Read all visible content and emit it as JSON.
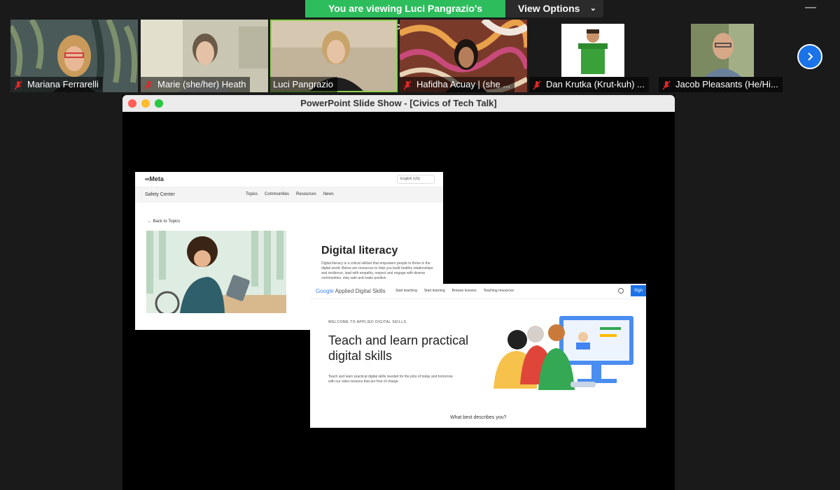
{
  "banner": {
    "viewing_text": "You are viewing Luci Pangrazio's screen",
    "view_options_label": "View Options",
    "minimize_label": "—"
  },
  "participants": [
    {
      "name": "Mariana Ferrarelli",
      "muted": true
    },
    {
      "name": "Marie (she/her) Heath",
      "muted": true
    },
    {
      "name": "Luci Pangrazio",
      "muted": false
    },
    {
      "name": "Hafidha Acuay | (she ...",
      "muted": true
    },
    {
      "name": "Dan Krutka (Krut-kuh) ...",
      "muted": true
    },
    {
      "name": "Jacob Pleasants (He/Hi...",
      "muted": true
    }
  ],
  "window": {
    "title": "PowerPoint Slide Show - [Civics of Tech Talk]"
  },
  "meta_page": {
    "logo": "∞Meta",
    "language": "English (US)",
    "section": "Safety Center",
    "nav": [
      "Topics",
      "Communities",
      "Resources",
      "News"
    ],
    "back_link": "← Back to Topics",
    "heading": "Digital literacy",
    "body": "Digital literacy is a critical skillset that empowers people to thrive in the digital world. Below are resources to help you build healthy relationships and resilience, lead with empathy, respect and engage with diverse communities, stay safe and make positive"
  },
  "google_page": {
    "logo_google": "Google",
    "logo_product": "Applied Digital Skills",
    "nav": [
      "Start teaching",
      "Start learning",
      "Browse lessons",
      "Teaching resources"
    ],
    "signin": "Sign",
    "eyebrow": "WELCOME TO APPLIED DIGITAL SKILLS",
    "heading": "Teach and learn practical digital skills",
    "body": "Teach and learn practical digital skills needed for the jobs of today and tomorrow with our video lessons that are free of charge.",
    "question": "What best describes you?"
  },
  "colors": {
    "banner_green": "#2dbd5d",
    "active_speaker": "#8fd14f",
    "zoom_blue": "#1a73e8",
    "mic_red": "#e02828"
  }
}
